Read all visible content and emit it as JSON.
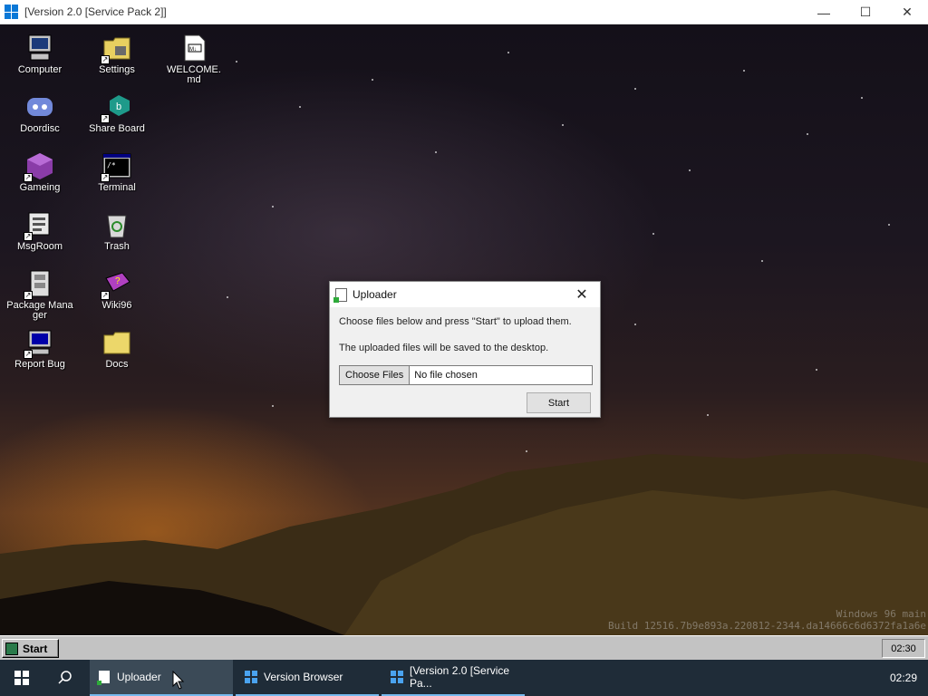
{
  "host_window": {
    "title": "[Version 2.0 [Service Pack 2]]",
    "controls": {
      "minimize": "—",
      "maximize": "☐",
      "close": "✕"
    }
  },
  "desktop": {
    "icons": [
      {
        "label": "Computer",
        "icon": "computer-icon"
      },
      {
        "label": "Settings",
        "icon": "settings-folder-icon"
      },
      {
        "label": "WELCOME.md",
        "icon": "markdown-file-icon"
      },
      {
        "label": "Doordisc",
        "icon": "doordisc-icon"
      },
      {
        "label": "Share Board",
        "icon": "share-board-icon"
      },
      {
        "label": "Gameing",
        "icon": "gameing-cube-icon"
      },
      {
        "label": "Terminal",
        "icon": "terminal-icon"
      },
      {
        "label": "MsgRoom",
        "icon": "msgroom-icon"
      },
      {
        "label": "Trash",
        "icon": "trash-icon"
      },
      {
        "label": "Package Manager",
        "icon": "package-manager-icon"
      },
      {
        "label": "Wiki96",
        "icon": "wiki96-book-icon"
      },
      {
        "label": "Report Bug",
        "icon": "report-bug-icon"
      },
      {
        "label": "Docs",
        "icon": "docs-folder-icon"
      }
    ],
    "watermark_line1": "Windows 96 main",
    "watermark_line2": "Build 12516.7b9e893a.220812-2344.da14666c6d6372fa1a6e"
  },
  "uploader": {
    "title": "Uploader",
    "close": "✕",
    "instruction": "Choose files below and press \"Start\" to upload them.",
    "note": "The uploaded files will be saved to the desktop.",
    "choose_label": "Choose Files",
    "file_status": "No file chosen",
    "start_label": "Start"
  },
  "w96_taskbar": {
    "start_label": "Start",
    "clock": "02:30"
  },
  "host_taskbar": {
    "apps": [
      {
        "label": "Uploader",
        "active": true
      },
      {
        "label": "Version Browser",
        "active": false
      },
      {
        "label": "[Version 2.0 [Service Pa...",
        "active": false
      }
    ],
    "clock": "02:29"
  }
}
